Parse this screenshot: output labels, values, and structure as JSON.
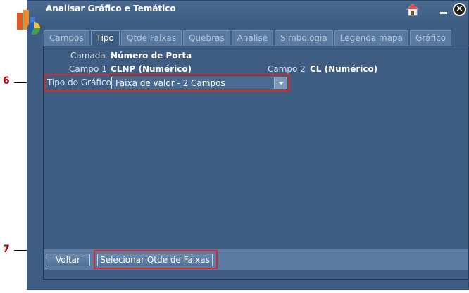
{
  "window": {
    "title": "Analisar Gráfico e Temático",
    "icons": {
      "home": "home-icon",
      "minimize": "minimize-icon",
      "close": "close-icon",
      "app": "app-logo"
    }
  },
  "tabs": [
    {
      "label": "Campos",
      "active": false
    },
    {
      "label": "Tipo",
      "active": true
    },
    {
      "label": "Qtde Faixas",
      "active": false
    },
    {
      "label": "Quebras",
      "active": false
    },
    {
      "label": "Análise",
      "active": false
    },
    {
      "label": "Simbologia",
      "active": false
    },
    {
      "label": "Legenda mapa",
      "active": false
    },
    {
      "label": "Gráfico",
      "active": false
    }
  ],
  "form": {
    "camada_label": "Camada",
    "camada_value": "Número de Porta",
    "campo1_label": "Campo 1",
    "campo1_value": "CLNP (Numérico)",
    "campo2_label": "Campo 2",
    "campo2_value": "CL (Numérico)",
    "tipo_label": "Tipo do Gráfico",
    "tipo_value": "Faixa de valor - 2 Campos"
  },
  "footer": {
    "back_label": "Voltar",
    "next_label": "Selecionar Qtde de Faixas"
  },
  "callouts": {
    "six": "6",
    "seven": "7"
  },
  "colors": {
    "window_bg": "#3f5d83",
    "callout": "#d12a2a"
  }
}
